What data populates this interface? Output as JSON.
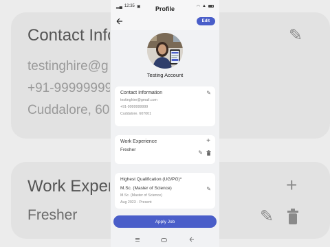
{
  "background": {
    "contact_title": "Contact Infor",
    "email": "testinghire@g",
    "phone": "+91-99999999",
    "address": "Cuddalore, 60",
    "work_title": "Work Experi",
    "work_value": "Fresher"
  },
  "status_bar": {
    "time": "12:35"
  },
  "header": {
    "title": "Profile",
    "edit_label": "Edit"
  },
  "profile": {
    "name": "Testing Account"
  },
  "contact": {
    "title": "Contact Information",
    "email": "testinghire@gmail.com",
    "phone": "+91-9999999999",
    "address": "Cuddalore. 607001"
  },
  "work": {
    "title": "Work Experience",
    "value": "Fresher"
  },
  "qualification": {
    "title": "Highest Qualification (UG/PG)*",
    "degree": "M.Sc. (Master of Science)",
    "degree_sub": "M.Sc. (Master of Science)",
    "duration": "Aug 2023 - Present"
  },
  "apply": {
    "label": "Apply Job"
  },
  "icons": {
    "back": "arrow-left-icon",
    "edit": "pencil-icon",
    "add": "plus-icon",
    "delete": "trash-icon"
  },
  "colors": {
    "accent": "#4a5ec9"
  }
}
